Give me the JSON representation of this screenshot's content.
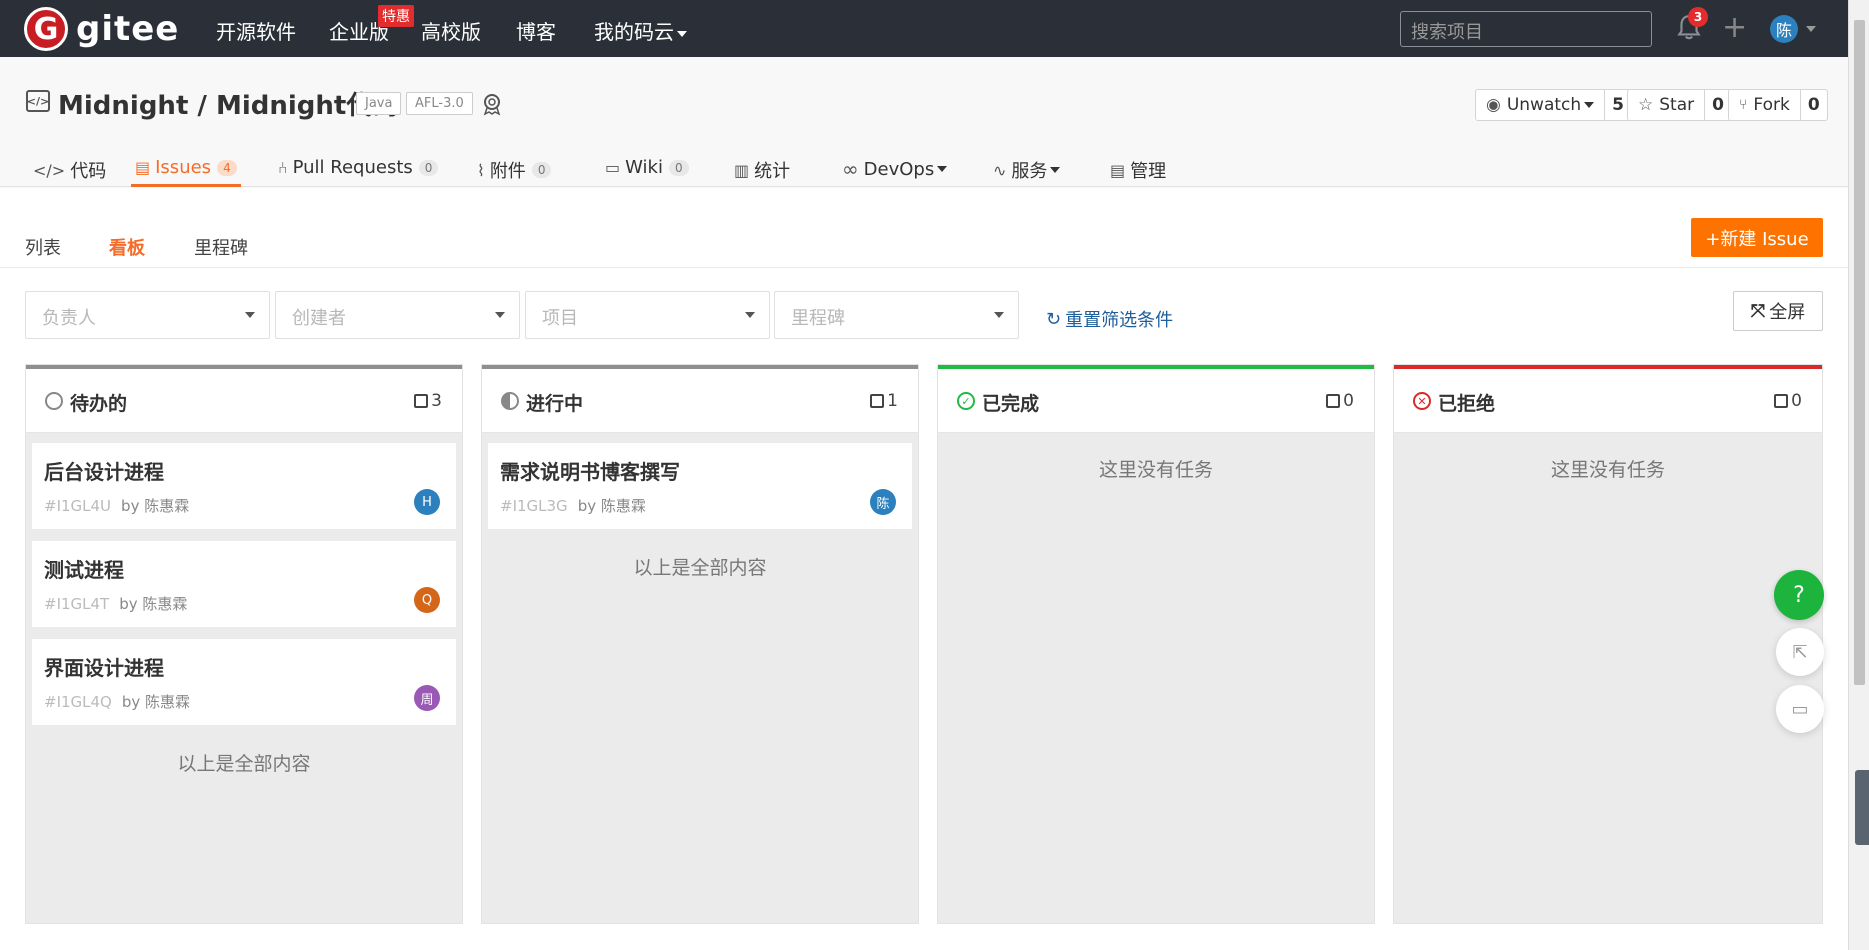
{
  "topnav": {
    "logo_text": "gitee",
    "logo_letter": "G",
    "items": [
      "开源软件",
      "企业版",
      "高校版",
      "博客",
      "我的码云"
    ],
    "enterprise_badge": "特惠",
    "search_placeholder": "搜索项目",
    "notification_count": "3",
    "avatar_text": "陈"
  },
  "repo": {
    "title": "Midnight / Midnight代码",
    "tags": [
      "Java",
      "AFL-3.0"
    ],
    "watch": {
      "label": "Unwatch",
      "count": "5"
    },
    "star": {
      "label": "Star",
      "count": "0"
    },
    "fork": {
      "label": "Fork",
      "count": "0"
    }
  },
  "tabs": [
    {
      "label": "代码",
      "icon": "code-icon"
    },
    {
      "label": "Issues",
      "count": "4",
      "icon": "issues-icon"
    },
    {
      "label": "Pull Requests",
      "count": "0",
      "icon": "pull-request-icon"
    },
    {
      "label": "附件",
      "count": "0",
      "icon": "attachment-icon"
    },
    {
      "label": "Wiki",
      "count": "0",
      "icon": "wiki-icon"
    },
    {
      "label": "统计",
      "icon": "stats-icon"
    },
    {
      "label": "DevOps",
      "icon": "devops-icon"
    },
    {
      "label": "服务",
      "icon": "service-icon"
    },
    {
      "label": "管理",
      "icon": "manage-icon"
    }
  ],
  "subtabs": [
    "列表",
    "看板",
    "里程碑"
  ],
  "new_issue_label": "+新建 Issue",
  "filters": [
    "负责人",
    "创建者",
    "项目",
    "里程碑"
  ],
  "reset_label": "重置筛选条件",
  "fullscreen_label": "全屏",
  "columns": [
    {
      "title": "待办的",
      "count": "3",
      "color": "#8f8f8f",
      "cards": [
        {
          "title": "后台设计进程",
          "id": "#I1GL4U",
          "by": "by 陈惠霖",
          "avatar": "H",
          "avatar_color": "#2b80bd"
        },
        {
          "title": "测试进程",
          "id": "#I1GL4T",
          "by": "by 陈惠霖",
          "avatar": "Q",
          "avatar_color": "#d4661a"
        },
        {
          "title": "界面设计进程",
          "id": "#I1GL4Q",
          "by": "by 陈惠霖",
          "avatar": "周",
          "avatar_color": "#9b59b6"
        }
      ],
      "footer": "以上是全部内容"
    },
    {
      "title": "进行中",
      "count": "1",
      "color": "#8f8f8f",
      "cards": [
        {
          "title": "需求说明书博客撰写",
          "id": "#I1GL3G",
          "by": "by 陈惠霖",
          "avatar": "陈",
          "avatar_color": "#2b80bd"
        }
      ],
      "footer": "以上是全部内容"
    },
    {
      "title": "已完成",
      "count": "0",
      "color": "#21ba45",
      "cards": [],
      "footer": "这里没有任务"
    },
    {
      "title": "已拒绝",
      "count": "0",
      "color": "#db2828",
      "cards": [],
      "footer": "这里没有任务"
    }
  ],
  "float_help": "?"
}
